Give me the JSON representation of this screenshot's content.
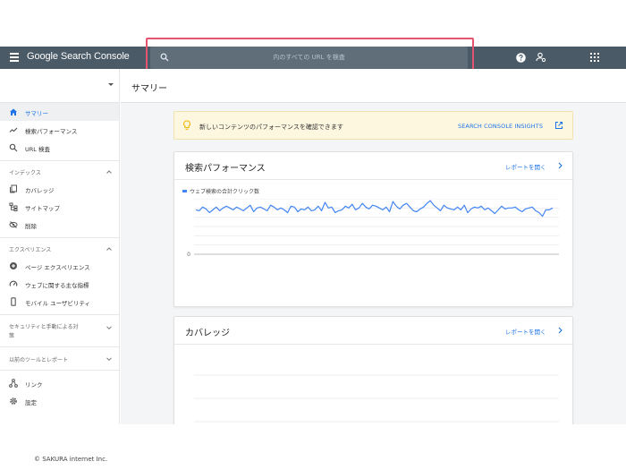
{
  "app": {
    "title": "Google Search Console"
  },
  "search": {
    "placeholder": "内のすべての URL を検査"
  },
  "sidebar": {
    "items": [
      {
        "label": "サマリー",
        "active": true
      },
      {
        "label": "検索パフォーマンス"
      },
      {
        "label": "URL 検査"
      }
    ],
    "sections": [
      {
        "title": "インデックス",
        "items": [
          {
            "label": "カバレッジ"
          },
          {
            "label": "サイトマップ"
          },
          {
            "label": "削除"
          }
        ]
      },
      {
        "title": "エクスペリエンス",
        "items": [
          {
            "label": "ページ エクスペリエンス"
          },
          {
            "label": "ウェブに関する主な指標"
          },
          {
            "label": "モバイル ユーザビリティ"
          }
        ]
      },
      {
        "title_line1": "セキュリティと手動による対",
        "title_line2": "策"
      },
      {
        "title": "以前のツールとレポート"
      }
    ],
    "footer_items": [
      {
        "label": "リンク"
      },
      {
        "label": "設定"
      }
    ]
  },
  "main": {
    "title": "サマリー",
    "insight": {
      "text": "新しいコンテンツのパフォーマンスを確認できます",
      "link": "SEARCH CONSOLE INSIGHTS"
    },
    "performance_card": {
      "title": "検索パフォーマンス",
      "link": "レポートを開く",
      "legend": "ウェブ検索の合計クリック数",
      "zero_label": "0"
    },
    "coverage_card": {
      "title": "カバレッジ",
      "link": "レポートを開く"
    }
  },
  "chart_data": {
    "type": "line",
    "series": [
      {
        "name": "ウェブ検索の合計クリック数",
        "values": [
          48,
          47,
          51,
          49,
          45,
          48,
          51,
          47,
          50,
          52,
          50,
          48,
          51,
          49,
          47,
          50,
          53,
          46,
          50,
          51,
          49,
          47,
          53,
          51,
          48,
          50,
          48,
          45,
          52,
          51,
          46,
          49,
          48,
          51,
          47,
          48,
          52,
          47,
          56,
          50,
          51,
          45,
          47,
          48,
          52,
          50,
          54,
          48,
          50,
          55,
          51,
          49,
          53,
          52,
          50,
          48,
          51,
          46,
          57,
          52,
          49,
          53,
          55,
          51,
          47,
          46,
          49,
          51,
          55,
          58,
          53,
          50,
          47,
          53,
          50,
          49,
          48,
          51,
          48,
          53,
          45,
          49,
          51,
          50,
          52,
          48,
          50,
          47,
          44,
          48,
          52,
          49,
          50,
          50,
          51,
          48,
          46,
          49,
          50,
          51,
          47,
          45,
          41,
          48,
          48,
          50
        ]
      }
    ],
    "ylim": [
      0,
      60
    ],
    "y_tick_labels": [
      "0"
    ],
    "grid": true
  },
  "footer": {
    "copyright": "© SAKURA internet Inc."
  },
  "colors": {
    "topbar": "#4a5a66",
    "accent": "#1a73e8",
    "highlight": "#e4546e",
    "insight_bg": "#fef7e0",
    "line": "#4285f4"
  }
}
